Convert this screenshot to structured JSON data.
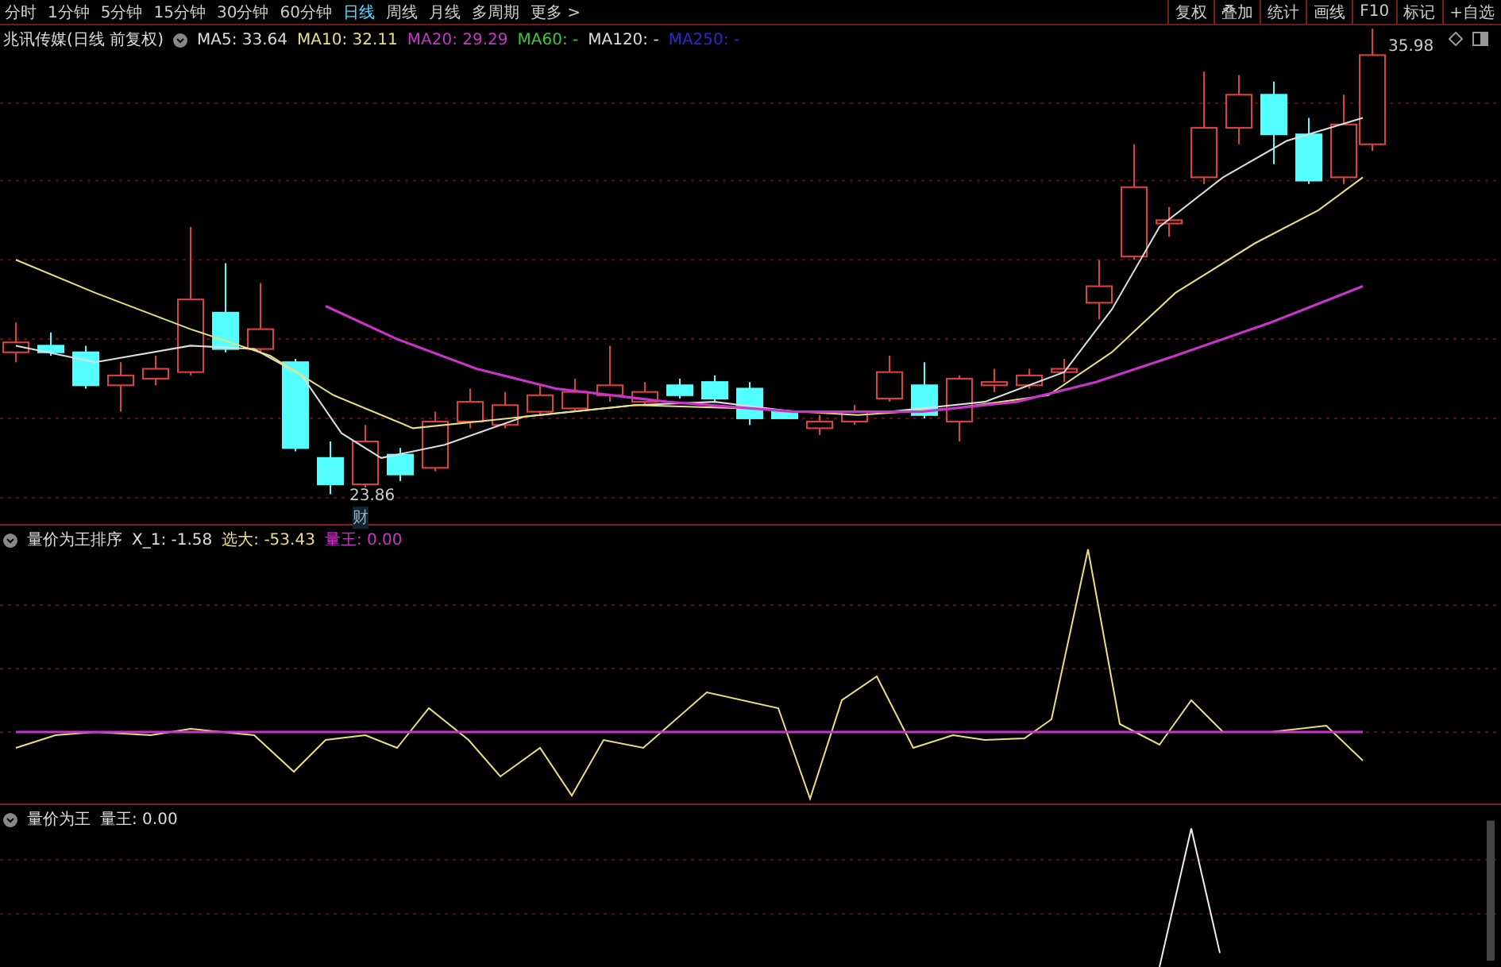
{
  "period_tabs": [
    {
      "label": "分时",
      "selected": false
    },
    {
      "label": "1分钟",
      "selected": false
    },
    {
      "label": "5分钟",
      "selected": false
    },
    {
      "label": "15分钟",
      "selected": false
    },
    {
      "label": "30分钟",
      "selected": false
    },
    {
      "label": "60分钟",
      "selected": false
    },
    {
      "label": "日线",
      "selected": true
    },
    {
      "label": "周线",
      "selected": false
    },
    {
      "label": "月线",
      "selected": false
    },
    {
      "label": "多周期",
      "selected": false
    },
    {
      "label": "更多 >",
      "selected": false
    }
  ],
  "tool_buttons": [
    "复权",
    "叠加",
    "统计",
    "画线",
    "F10",
    "标记",
    "+自选"
  ],
  "price_pane": {
    "title": "兆讯传媒(日线 前复权)",
    "legend": [
      {
        "label": "MA5: 33.64",
        "color": "#dddddd"
      },
      {
        "label": "MA10: 32.11",
        "color": "#e8e07a"
      },
      {
        "label": "MA20: 29.29",
        "color": "#cc33cc"
      },
      {
        "label": "MA60: -",
        "color": "#33cc33"
      },
      {
        "label": "MA120: -",
        "color": "#dddddd"
      },
      {
        "label": "MA250: -",
        "color": "#2a2ad0"
      }
    ],
    "high_label": "35.98",
    "low_label": "23.86",
    "low_badge": "财"
  },
  "indicator_pane": {
    "title": "量价为王排序",
    "legend": [
      {
        "label": "X_1: -1.58",
        "color": "#dddddd"
      },
      {
        "label": "选大: -53.43",
        "color": "#e8e07a"
      },
      {
        "label": "量王: 0.00",
        "color": "#cc33cc"
      }
    ]
  },
  "volume_pane": {
    "title": "量价为王",
    "legend": [
      {
        "label": "量王: 0.00",
        "color": "#dddddd"
      }
    ]
  }
}
